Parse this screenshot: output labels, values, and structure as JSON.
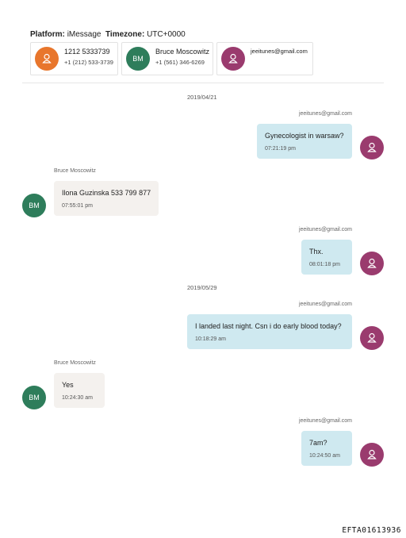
{
  "header": {
    "platform_label": "Platform:",
    "platform_value": "iMessage",
    "timezone_label": "Timezone:",
    "timezone_value": "UTC+0000"
  },
  "participants": [
    {
      "name": "1212 5333739",
      "number": "+1 (212) 533-3739",
      "avatar": "person-icon",
      "color": "#e8762c"
    },
    {
      "name": "Bruce Moscowitz",
      "number": "+1 (561) 346-6269",
      "initials": "BM",
      "color": "#2e7d5b"
    },
    {
      "name": "jeeitunes@gmail.com",
      "avatar": "person-icon",
      "color": "#9a3b6e"
    }
  ],
  "conversation": {
    "dates": [
      "2019/04/21",
      "2019/05/29"
    ],
    "messages": [
      {
        "direction": "out",
        "sender": "jeeitunes@gmail.com",
        "text": "Gynecologist in warsaw?",
        "time": "07:21:19 pm"
      },
      {
        "direction": "in",
        "sender": "Bruce Moscowitz",
        "initials": "BM",
        "text": "Ilona Guzinska 533 799 877",
        "time": "07:55:01 pm"
      },
      {
        "direction": "out",
        "sender": "jeeitunes@gmail.com",
        "text": "Thx.",
        "time": "08:01:18 pm"
      },
      {
        "direction": "out",
        "sender": "jeeitunes@gmail.com",
        "text": "I landed last night. Csn i do early blood today?",
        "time": "10:18:29 am"
      },
      {
        "direction": "in",
        "sender": "Bruce Moscowitz",
        "initials": "BM",
        "text": "Yes",
        "time": "10:24:30 am"
      },
      {
        "direction": "out",
        "sender": "jeeitunes@gmail.com",
        "text": "7am?",
        "time": "10:24:50 am"
      }
    ]
  },
  "footer": {
    "doc_id": "EFTA01613936"
  },
  "colors": {
    "outgoing_bubble": "#cfe9f0",
    "incoming_bubble": "#f4f1ee"
  }
}
